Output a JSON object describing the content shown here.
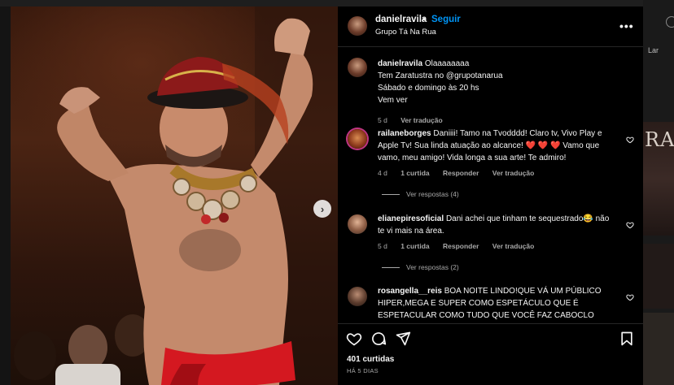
{
  "background": {
    "right_label": "Lar",
    "right_poster_text": "RA"
  },
  "post": {
    "carousel_next_icon": "chevron-right-icon"
  },
  "header": {
    "username": "danielravila",
    "dot": "•",
    "follow_label": "Seguir",
    "location": "Grupo Tá Na Rua",
    "more_icon": "more-horizontal-icon",
    "more_label": "•••"
  },
  "comments": [
    {
      "username": "danielravila",
      "text_lines": [
        "Olaaaaaaaa",
        "Tem Zaratustra no @grupotanarua",
        "Sábado e domingo às 20 hs",
        "Vem ver"
      ],
      "time": "5 d",
      "translate": "Ver tradução"
    },
    {
      "username": "railaneborges",
      "text": "Daniiii! Tamo na Tvodddd! Claro tv, Vivo Play e Apple Tv! Sua linda atuação ao alcance! ❤️ ❤️ ❤️ Vamo que vamo, meu amigo! Vida longa a sua arte! Te admiro!",
      "time": "4 d",
      "likes": "1 curtida",
      "reply": "Responder",
      "translate": "Ver tradução",
      "view_replies": "Ver respostas (4)"
    },
    {
      "username": "elianepiresoficial",
      "text": "Dani achei que tinham te sequestrado😂 não te vi mais na área.",
      "time": "5 d",
      "likes": "1 curtida",
      "reply": "Responder",
      "translate": "Ver tradução",
      "view_replies": "Ver respostas (2)"
    },
    {
      "username": "rosangella__reis",
      "text": "BOA NOITE LINDO!QUE VÁ UM PÚBLICO HIPER,MEGA E SUPER COMO ESPETÁCULO QUE É ESPETACULAR COMO TUDO QUE VOCÊ FAZ CABOCLO"
    }
  ],
  "actions": {
    "like_icon": "heart-outline-icon",
    "comment_icon": "comment-icon",
    "share_icon": "send-icon",
    "save_icon": "bookmark-icon",
    "likes_count": "401 curtidas",
    "date": "HÁ 5 DIAS"
  },
  "colors": {
    "accent": "#0095f6",
    "panel_bg": "#000000",
    "muted_text": "#a8a8a8",
    "heart_red": "#ff3040"
  }
}
